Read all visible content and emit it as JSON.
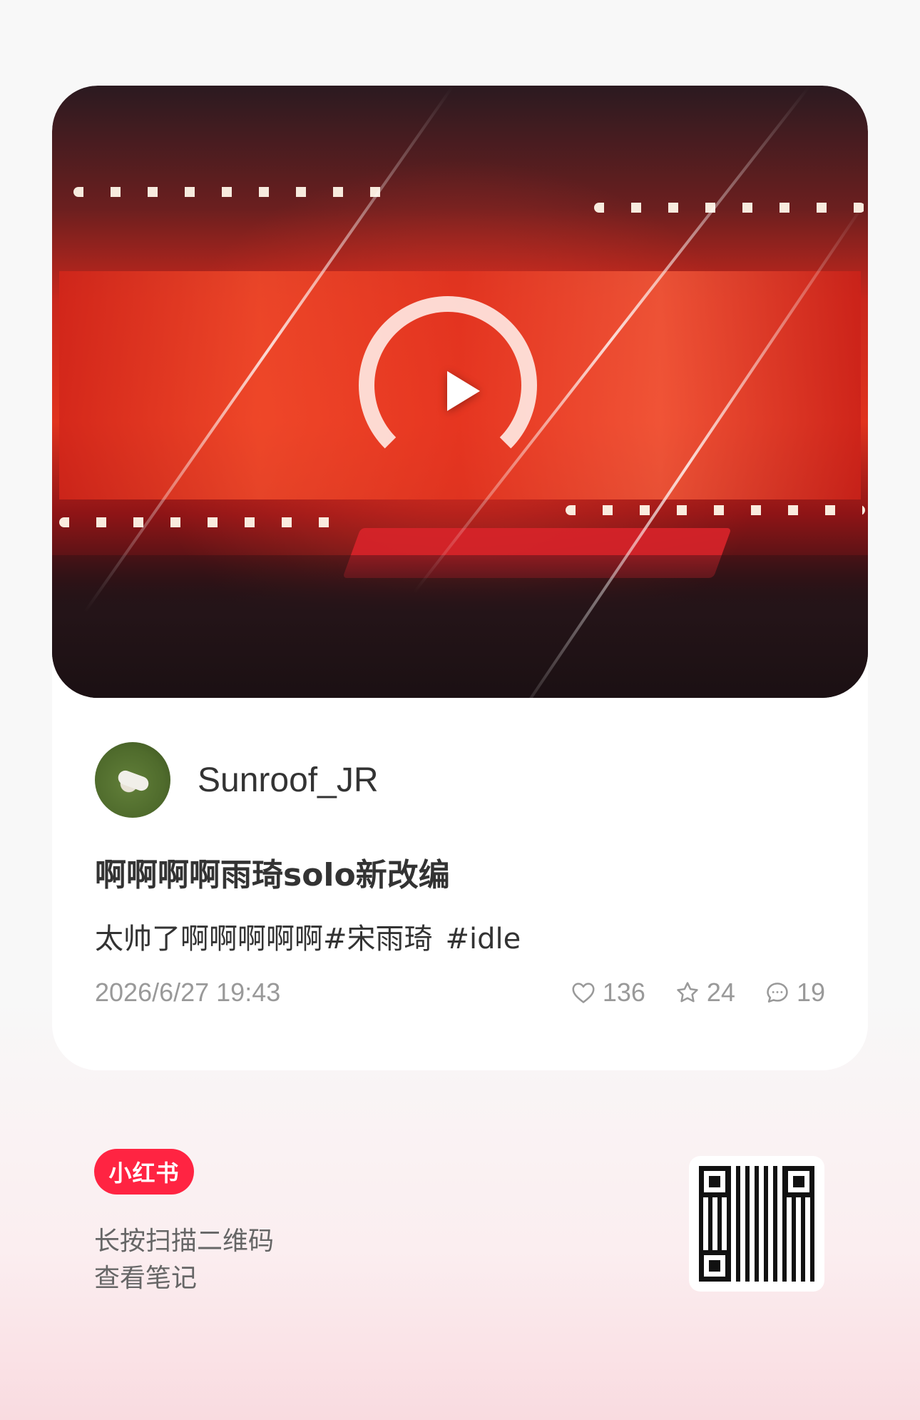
{
  "post": {
    "author": "Sunroof_JR",
    "title": "啊啊啊啊雨琦solo新改编",
    "description": "太帅了啊啊啊啊啊#宋雨琦",
    "tag": "#idle",
    "timestamp": "2026/6/27 19:43",
    "likes": "136",
    "favorites": "24",
    "comments": "19"
  },
  "footer": {
    "brand": "小红书",
    "hint_line1": "长按扫描二维码",
    "hint_line2": "查看笔记"
  },
  "icons": {
    "play": "play-icon",
    "like": "heart-icon",
    "favorite": "star-icon",
    "comment": "comment-icon"
  },
  "colors": {
    "brand_red": "#ff2442",
    "muted": "#999999"
  }
}
